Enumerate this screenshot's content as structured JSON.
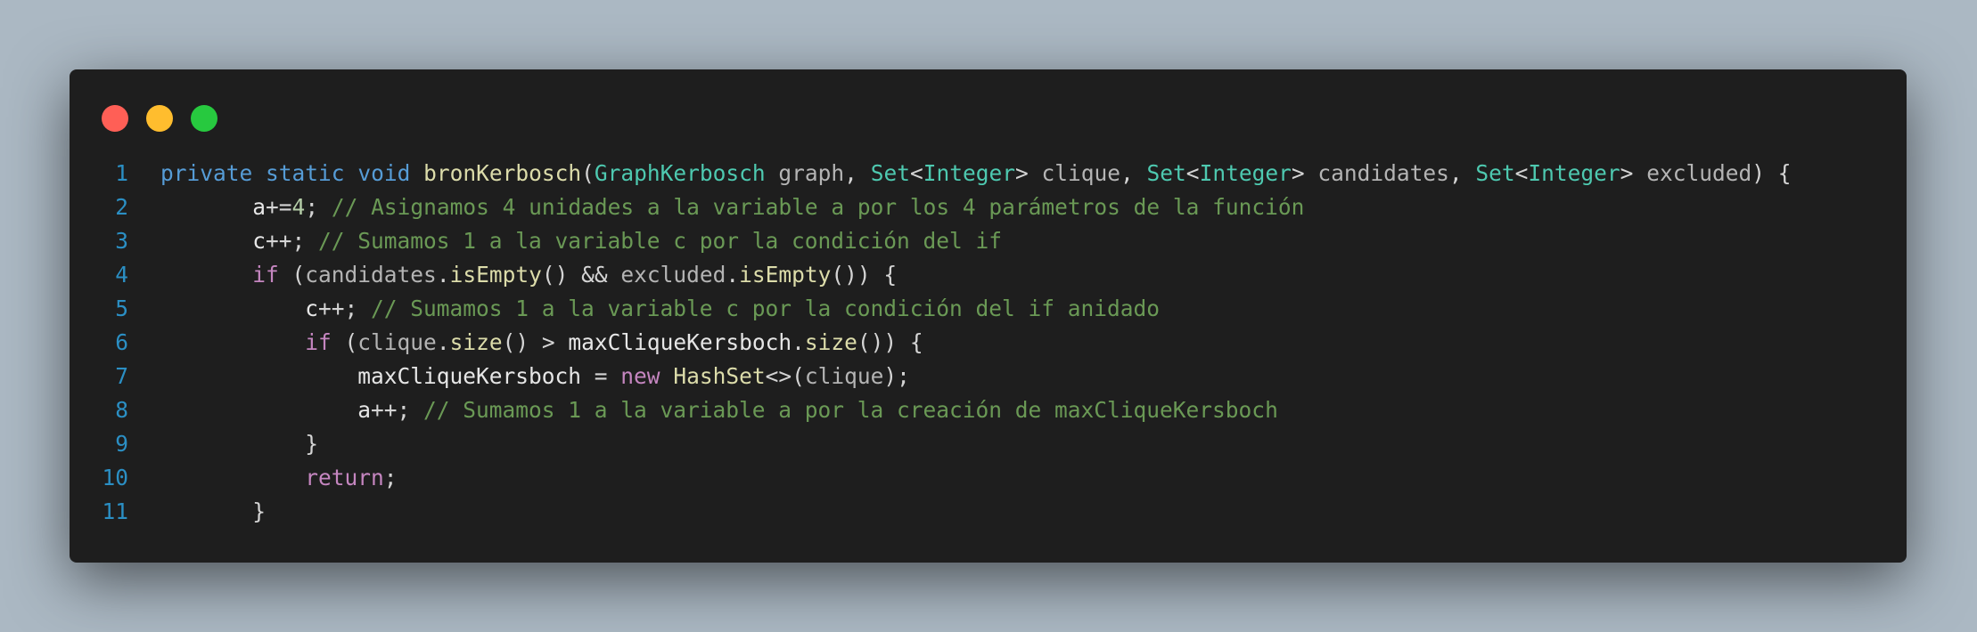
{
  "window": {
    "controls": [
      {
        "name": "close-dot",
        "color": "#ff5f56"
      },
      {
        "name": "minimize-dot",
        "color": "#ffbd2e"
      },
      {
        "name": "maximize-dot",
        "color": "#27c93f"
      }
    ]
  },
  "code": {
    "lines": [
      {
        "number": "1",
        "tokens": [
          {
            "t": "private",
            "c": "kw"
          },
          {
            "t": " ",
            "c": "plain"
          },
          {
            "t": "static",
            "c": "kw"
          },
          {
            "t": " ",
            "c": "plain"
          },
          {
            "t": "void",
            "c": "kw"
          },
          {
            "t": " ",
            "c": "plain"
          },
          {
            "t": "bronKerbosch",
            "c": "fn"
          },
          {
            "t": "(",
            "c": "plain"
          },
          {
            "t": "GraphKerbosch",
            "c": "type"
          },
          {
            "t": " ",
            "c": "plain"
          },
          {
            "t": "graph",
            "c": "param"
          },
          {
            "t": ", ",
            "c": "plain"
          },
          {
            "t": "Set",
            "c": "type"
          },
          {
            "t": "<",
            "c": "plain"
          },
          {
            "t": "Integer",
            "c": "type"
          },
          {
            "t": "> ",
            "c": "plain"
          },
          {
            "t": "clique",
            "c": "param"
          },
          {
            "t": ", ",
            "c": "plain"
          },
          {
            "t": "Set",
            "c": "type"
          },
          {
            "t": "<",
            "c": "plain"
          },
          {
            "t": "Integer",
            "c": "type"
          },
          {
            "t": "> ",
            "c": "plain"
          },
          {
            "t": "candidates",
            "c": "param"
          },
          {
            "t": ", ",
            "c": "plain"
          },
          {
            "t": "Set",
            "c": "type"
          },
          {
            "t": "<",
            "c": "plain"
          },
          {
            "t": "Integer",
            "c": "type"
          },
          {
            "t": "> ",
            "c": "plain"
          },
          {
            "t": "excluded",
            "c": "param"
          },
          {
            "t": ") {",
            "c": "plain"
          }
        ]
      },
      {
        "number": "2",
        "tokens": [
          {
            "t": "       ",
            "c": "plain"
          },
          {
            "t": "a",
            "c": "var"
          },
          {
            "t": "+=",
            "c": "plain"
          },
          {
            "t": "4",
            "c": "num"
          },
          {
            "t": "; ",
            "c": "plain"
          },
          {
            "t": "// Asignamos 4 unidades a la variable a por los 4 parámetros de la función",
            "c": "cmt"
          }
        ]
      },
      {
        "number": "3",
        "tokens": [
          {
            "t": "       ",
            "c": "plain"
          },
          {
            "t": "c",
            "c": "var"
          },
          {
            "t": "++; ",
            "c": "plain"
          },
          {
            "t": "// Sumamos 1 a la variable c por la condición del if",
            "c": "cmt"
          }
        ]
      },
      {
        "number": "4",
        "tokens": [
          {
            "t": "       ",
            "c": "plain"
          },
          {
            "t": "if",
            "c": "ctrl"
          },
          {
            "t": " (",
            "c": "plain"
          },
          {
            "t": "candidates",
            "c": "param"
          },
          {
            "t": ".",
            "c": "plain"
          },
          {
            "t": "isEmpty",
            "c": "fn"
          },
          {
            "t": "() && ",
            "c": "plain"
          },
          {
            "t": "excluded",
            "c": "param"
          },
          {
            "t": ".",
            "c": "plain"
          },
          {
            "t": "isEmpty",
            "c": "fn"
          },
          {
            "t": "()) {",
            "c": "plain"
          }
        ]
      },
      {
        "number": "5",
        "tokens": [
          {
            "t": "           ",
            "c": "plain"
          },
          {
            "t": "c",
            "c": "var"
          },
          {
            "t": "++; ",
            "c": "plain"
          },
          {
            "t": "// Sumamos 1 a la variable c por la condición del if anidado",
            "c": "cmt"
          }
        ]
      },
      {
        "number": "6",
        "tokens": [
          {
            "t": "           ",
            "c": "plain"
          },
          {
            "t": "if",
            "c": "ctrl"
          },
          {
            "t": " (",
            "c": "plain"
          },
          {
            "t": "clique",
            "c": "param"
          },
          {
            "t": ".",
            "c": "plain"
          },
          {
            "t": "size",
            "c": "fn"
          },
          {
            "t": "() > ",
            "c": "plain"
          },
          {
            "t": "maxCliqueKersboch",
            "c": "var"
          },
          {
            "t": ".",
            "c": "plain"
          },
          {
            "t": "size",
            "c": "fn"
          },
          {
            "t": "()) {",
            "c": "plain"
          }
        ]
      },
      {
        "number": "7",
        "tokens": [
          {
            "t": "               ",
            "c": "plain"
          },
          {
            "t": "maxCliqueKersboch",
            "c": "var"
          },
          {
            "t": " = ",
            "c": "plain"
          },
          {
            "t": "new",
            "c": "ctrl"
          },
          {
            "t": " ",
            "c": "plain"
          },
          {
            "t": "HashSet",
            "c": "fn"
          },
          {
            "t": "<>(",
            "c": "plain"
          },
          {
            "t": "clique",
            "c": "param"
          },
          {
            "t": ");",
            "c": "plain"
          }
        ]
      },
      {
        "number": "8",
        "tokens": [
          {
            "t": "               ",
            "c": "plain"
          },
          {
            "t": "a",
            "c": "var"
          },
          {
            "t": "++; ",
            "c": "plain"
          },
          {
            "t": "// Sumamos 1 a la variable a por la creación de maxCliqueKersboch",
            "c": "cmt"
          }
        ]
      },
      {
        "number": "9",
        "tokens": [
          {
            "t": "           ",
            "c": "plain"
          },
          {
            "t": "}",
            "c": "plain"
          }
        ]
      },
      {
        "number": "10",
        "tokens": [
          {
            "t": "           ",
            "c": "plain"
          },
          {
            "t": "return",
            "c": "ctrl"
          },
          {
            "t": ";",
            "c": "plain"
          }
        ]
      },
      {
        "number": "11",
        "tokens": [
          {
            "t": "       ",
            "c": "plain"
          },
          {
            "t": "}",
            "c": "plain"
          }
        ]
      }
    ]
  }
}
